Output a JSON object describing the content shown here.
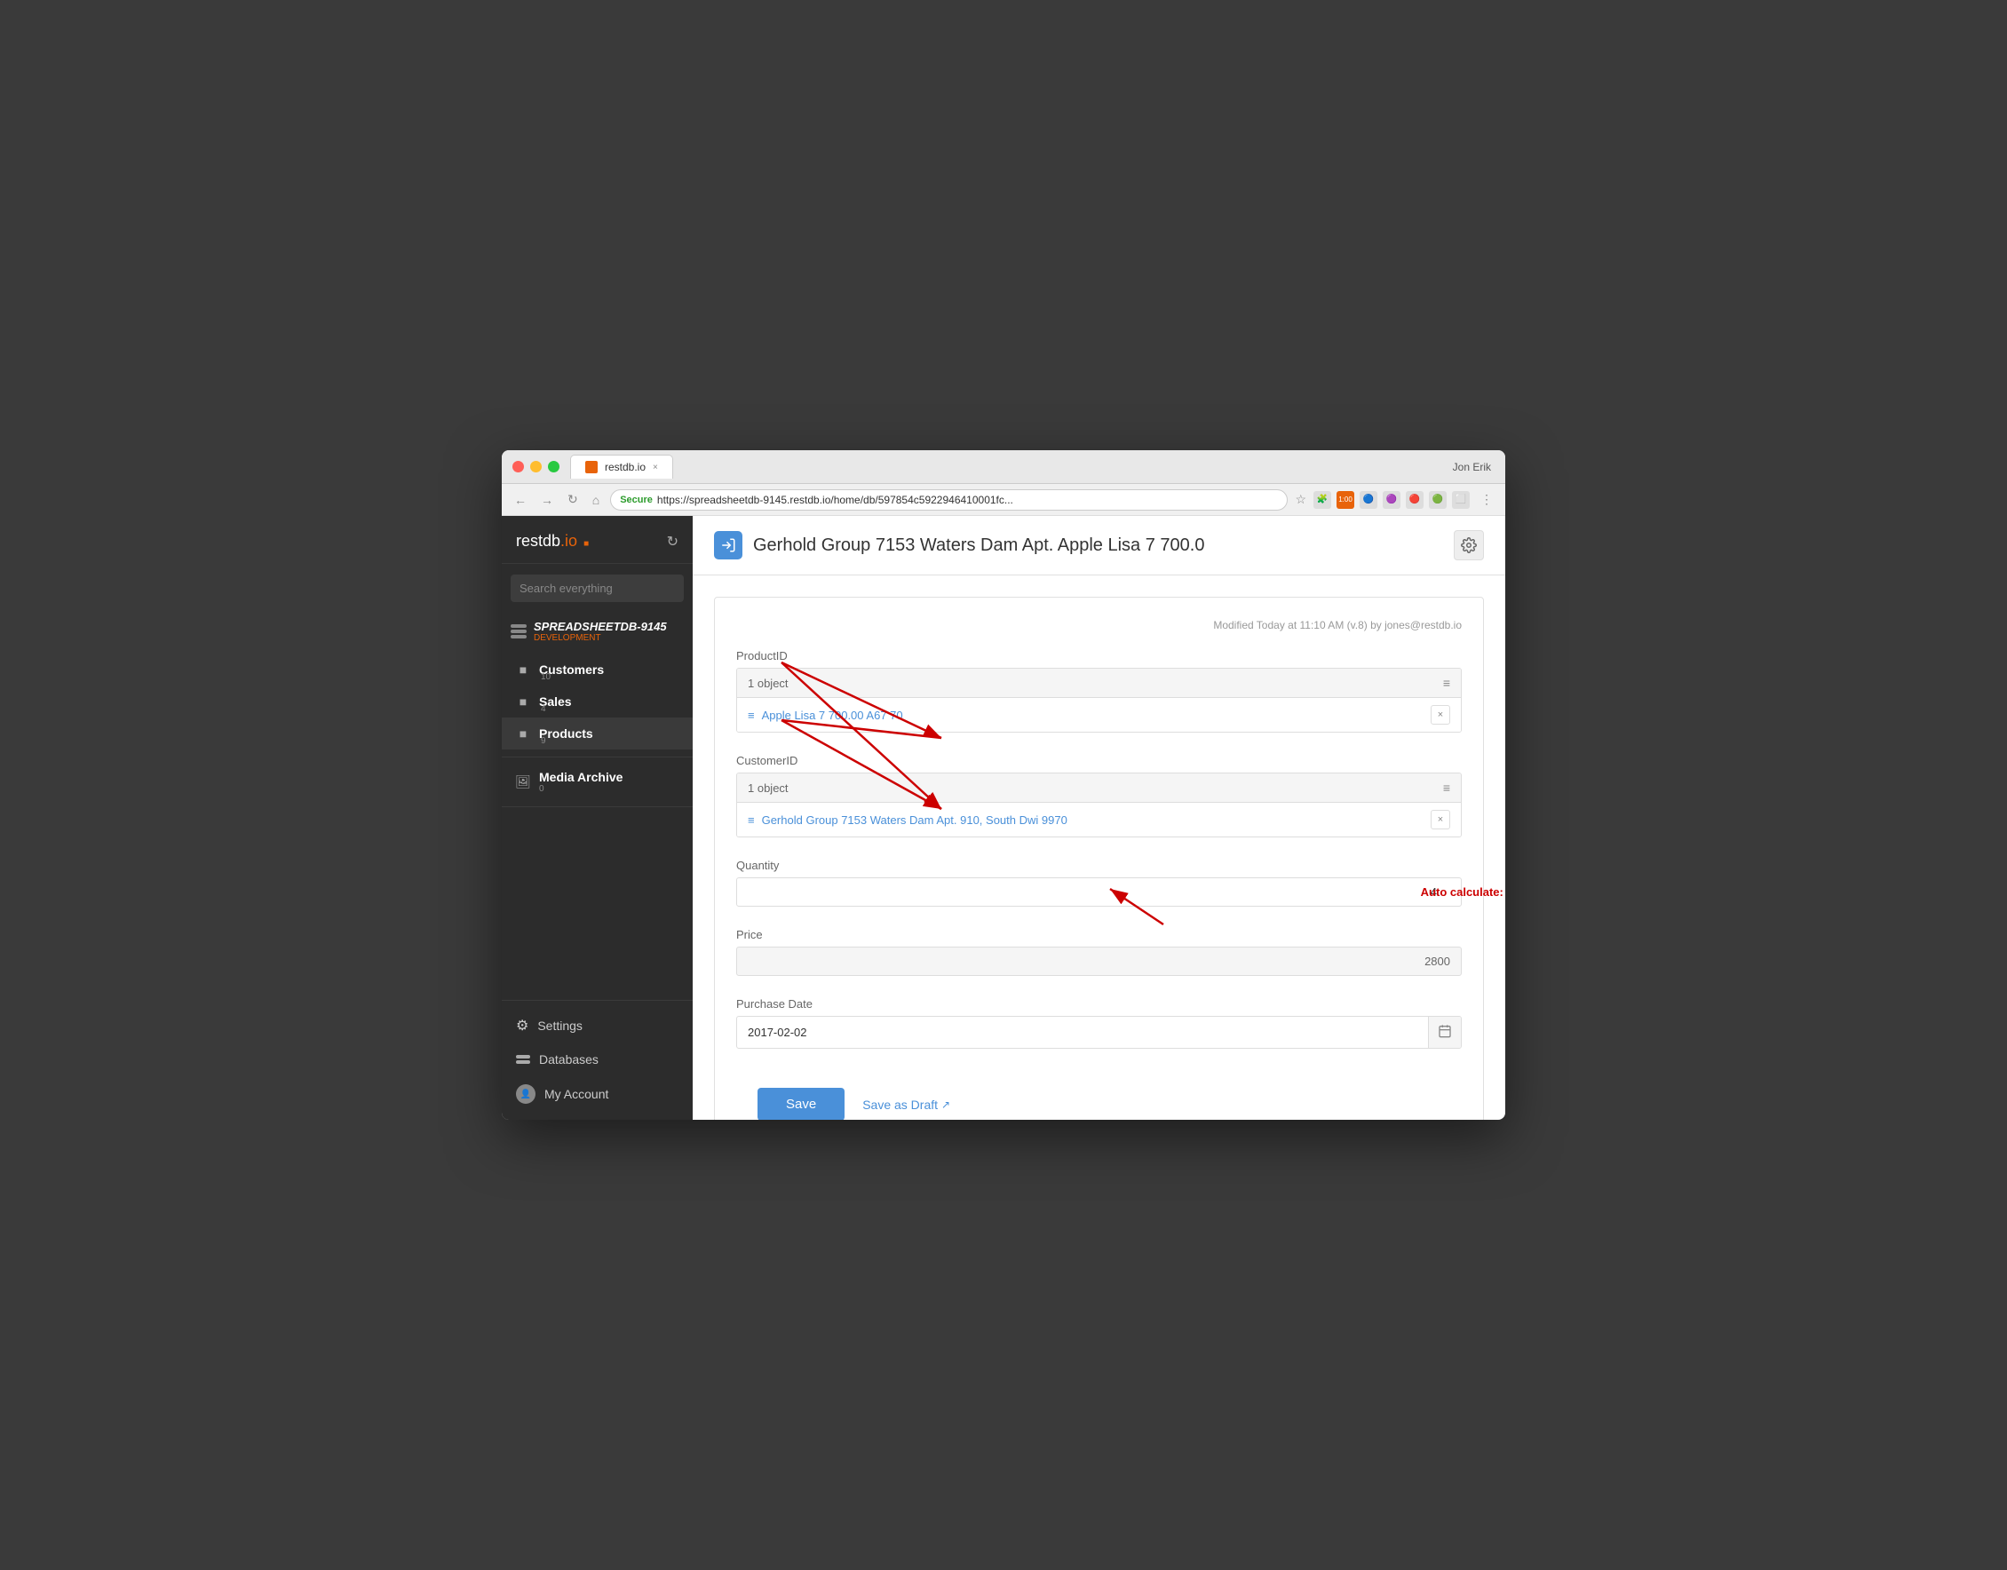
{
  "browser": {
    "tab_title": "restdb.io",
    "tab_close": "×",
    "user_name": "Jon Erik",
    "url_secure": "Secure",
    "url_full": "https://spreadsheetdb-9145.restdb.io/home/db/597854c5922946410001fc...",
    "favicon_alt": "restdb favicon"
  },
  "sidebar": {
    "logo": "restdb",
    "logo_suffix": ".io",
    "db_name": "spreadsheetdb-9145",
    "db_env": "development",
    "search_placeholder": "Search everything",
    "items": [
      {
        "label": "Customers",
        "count": "10",
        "icon": "table-icon"
      },
      {
        "label": "Sales",
        "count": "4",
        "icon": "table-icon"
      },
      {
        "label": "Products",
        "count": "9",
        "icon": "table-icon"
      }
    ],
    "media_label": "Media Archive",
    "media_count": "0",
    "bottom_items": [
      {
        "label": "Settings",
        "icon": "gear-icon"
      },
      {
        "label": "Databases",
        "icon": "databases-icon"
      },
      {
        "label": "My Account",
        "icon": "avatar-icon"
      }
    ]
  },
  "header": {
    "title": "Gerhold Group 7153 Waters Dam Apt. Apple Lisa 7 700.0",
    "settings_icon": "⚙",
    "modified_text": "Modified Today at 11:10 AM (v.8) by jones@restdb.io"
  },
  "form": {
    "product_id_label": "ProductID",
    "product_id_count": "1 object",
    "product_id_link": "Apple Lisa 7 700.00 A67 70",
    "customer_id_label": "CustomerID",
    "customer_id_count": "1 object",
    "customer_id_link": "Gerhold Group 7153 Waters Dam Apt. 910, South Dwi 9970",
    "quantity_label": "Quantity",
    "quantity_value": "4",
    "price_label": "Price",
    "price_value": "2800",
    "purchase_date_label": "Purchase Date",
    "purchase_date_value": "2017-02-02",
    "save_label": "Save",
    "draft_label": "Save as Draft",
    "auto_calc_note": "Auto calculate: Product.Price * Quantity"
  },
  "icons": {
    "lock": "🔒",
    "star": "☆",
    "calendar": "📅",
    "gear": "⚙",
    "menu": "≡"
  }
}
